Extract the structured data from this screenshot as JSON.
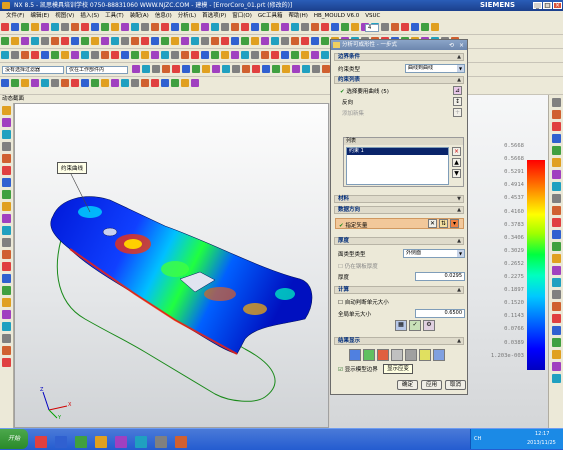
{
  "window": {
    "title": "NX 8.5 - 凯思模具培训学校 0750-88831060 WWW.NJZC.COM - 建模 - [ErrorCoro_01.prt (修改的)]",
    "brand": "SIEMENS"
  },
  "menu": [
    "文件(F)",
    "编辑(E)",
    "视图(V)",
    "插入(S)",
    "工具(T)",
    "装配(A)",
    "信息(I)",
    "分析(L)",
    "首选项(P)",
    "窗口(O)",
    "GC工具箱",
    "帮助(H)",
    "HB_MOULD V6.0",
    "VSUC"
  ],
  "toolbar": {
    "filter_select": "没有选择过滤器",
    "scope_select": "仅在工作部件内",
    "num_field": "4"
  },
  "viewport": {
    "title": "动态截面",
    "callout": "约束曲线"
  },
  "legend": {
    "values": [
      "0.5668",
      "0.5668",
      "0.5291",
      "0.4914",
      "0.4537",
      "0.4160",
      "0.3783",
      "0.3406",
      "0.3029",
      "0.2652",
      "0.2275",
      "0.1897",
      "0.1520",
      "0.1143",
      "0.0766",
      "0.0389",
      "1.203e-003"
    ]
  },
  "dialog": {
    "title": "分析可成形性 - 一步式",
    "boundary_section": "边界条件",
    "constraint_type_label": "约束类型",
    "constraint_type_value": "曲线到曲线",
    "constraint_list_section": "约束列表",
    "select_curve": "选择要用曲线 (5)",
    "reverse_label": "反向",
    "add_label": "添加新集",
    "list_section": "列表",
    "list_item": "约束 1",
    "material_section": "材料",
    "direction_section": "数据方向",
    "specify_vector": "指定矢量",
    "thickness_section": "厚度",
    "face_type_label": "面类型类型",
    "face_type_value": "外侧面",
    "use_thickness": "仍在钢板厚度",
    "thickness_label": "厚度",
    "thickness_value": "0.0295",
    "calc_section": "计算",
    "auto_mesh": "自动判断单元大小",
    "global_size_label": "全局单元大小",
    "global_size_value": "0.6500",
    "results_section": "结果显示",
    "show_results": "显示模型边界",
    "tooltip": "显示应变",
    "ok": "确定",
    "apply": "应用",
    "cancel": "取消"
  },
  "taskbar": {
    "start": "开始",
    "time": "12:17",
    "date": "2013/11/25",
    "lang": "CH"
  },
  "triad": {
    "x": "X",
    "y": "Y",
    "z": "Z"
  }
}
